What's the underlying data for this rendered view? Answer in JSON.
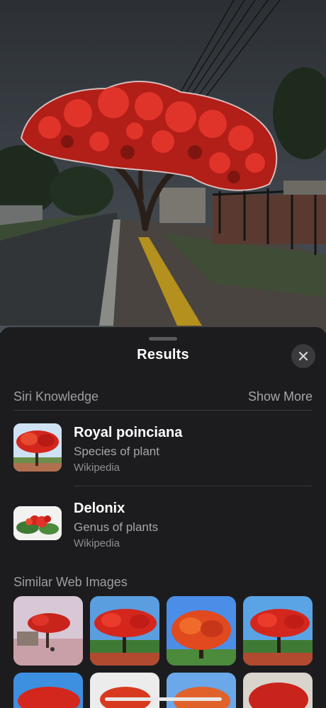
{
  "sheet": {
    "title": "Results",
    "close_icon": "close-icon"
  },
  "siri_knowledge": {
    "heading": "Siri Knowledge",
    "show_more": "Show More",
    "results": [
      {
        "title": "Royal poinciana",
        "subtitle": "Species of plant",
        "source": "Wikipedia"
      },
      {
        "title": "Delonix",
        "subtitle": "Genus of plants",
        "source": "Wikipedia"
      }
    ]
  },
  "web_images": {
    "heading": "Similar Web Images",
    "count": 8
  },
  "colors": {
    "sheet_bg": "#1c1c1e",
    "secondary_text": "#9e9ea3",
    "flower_red": "#d3271e"
  }
}
